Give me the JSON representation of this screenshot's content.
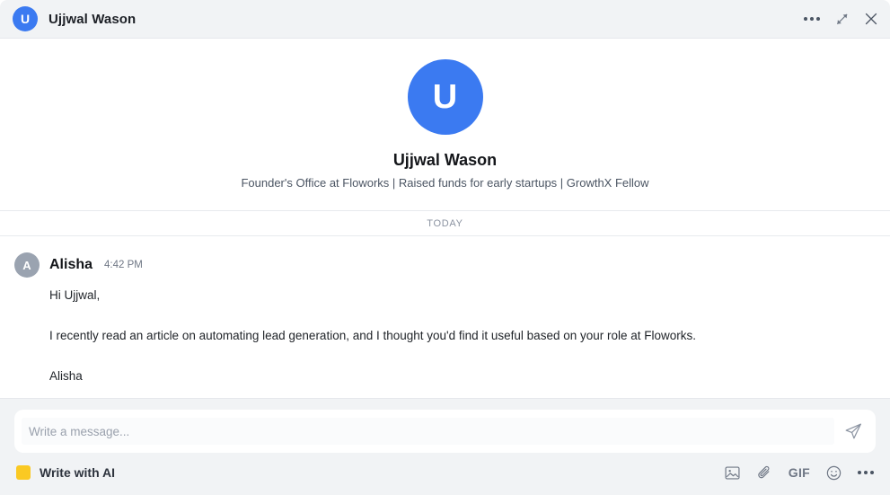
{
  "window": {
    "title": "Ujjwal Wason",
    "avatar_initial": "U",
    "accent_color": "#3b7af1",
    "actions": [
      {
        "name": "more-options",
        "icon": "ellipsis-horizontal-icon",
        "label": "More options"
      },
      {
        "name": "expand",
        "icon": "expand-diagonal-icon",
        "label": "Expand"
      },
      {
        "name": "close",
        "icon": "close-icon",
        "label": "Close"
      }
    ]
  },
  "profile": {
    "avatar_initial": "U",
    "name": "Ujjwal Wason",
    "headline": "Founder's Office at Floworks | Raised funds for early startups | GrowthX Fellow"
  },
  "conversation": {
    "day_divider": "TODAY",
    "messages": [
      {
        "avatar_initial": "A",
        "sender": "Alisha",
        "time": "4:42 PM",
        "paragraphs": [
          "Hi Ujjwal,",
          "I recently read an article on automating lead generation, and I thought you'd find it useful based on your role at Floworks.",
          "Alisha"
        ]
      }
    ]
  },
  "composer": {
    "placeholder": "Write a message...",
    "value": "",
    "send_label": "Send",
    "ai": {
      "label": "Write with AI",
      "swatch_color": "#fac923"
    },
    "tools": [
      {
        "name": "insert-image",
        "icon": "image-icon",
        "label": "Image"
      },
      {
        "name": "attach-file",
        "icon": "paperclip-icon",
        "label": "Attach"
      },
      {
        "name": "insert-gif",
        "icon": "gif-icon",
        "label": "GIF"
      },
      {
        "name": "insert-emoji",
        "icon": "smiley-icon",
        "label": "Emoji"
      },
      {
        "name": "more-tools",
        "icon": "ellipsis-horizontal-icon",
        "label": "More"
      }
    ],
    "gif_label": "GIF"
  }
}
